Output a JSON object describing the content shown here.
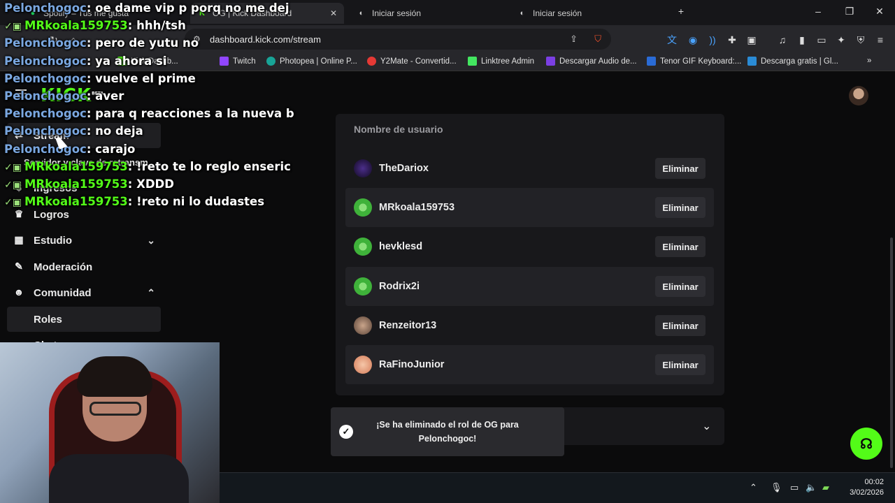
{
  "browser": {
    "tabs": [
      {
        "label": "Spotify – Tus me gusta"
      },
      {
        "label": "OG | Kick Dashboard"
      },
      {
        "label": "Iniciar sesión"
      },
      {
        "label": "Iniciar sesión"
      }
    ],
    "url": "dashboard.kick.com/stream",
    "bookmarks": [
      {
        "label": "Kick Dashb..."
      },
      {
        "label": "Twitch"
      },
      {
        "label": "Photopea | Online P..."
      },
      {
        "label": "Y2Mate - Convertid..."
      },
      {
        "label": "Linktree Admin"
      },
      {
        "label": "Descargar Audio de..."
      },
      {
        "label": "Tenor GIF Keyboard:..."
      },
      {
        "label": "Descarga gratis | Gl..."
      }
    ],
    "colors": {
      "chrome": "#27272b",
      "tabbar": "#161619"
    }
  },
  "app": {
    "logo": "KICK",
    "logo_tag": "BETA",
    "accent": "#53fc18",
    "sidebar": {
      "items": [
        {
          "label": "Stream",
          "icon": "stream-icon"
        },
        {
          "label": "Servidor y clave de retransm"
        },
        {
          "label": "Ingresos",
          "icon": "money-icon"
        },
        {
          "label": "Logros",
          "icon": "trophy-icon"
        },
        {
          "label": "Estudio",
          "icon": "studio-icon"
        },
        {
          "label": "Moderación",
          "icon": "wrench-icon"
        },
        {
          "label": "Comunidad",
          "icon": "people-icon"
        },
        {
          "label": "Roles"
        },
        {
          "label": "Chat"
        }
      ]
    },
    "table": {
      "column_header": "Nombre de usuario",
      "delete_label": "Eliminar",
      "rows": [
        {
          "username": "TheDariox",
          "avatar_color": "#2a1b4a"
        },
        {
          "username": "MRkoala159753",
          "avatar_color": "#3fb23a"
        },
        {
          "username": "hevklesd",
          "avatar_color": "#3fb23a"
        },
        {
          "username": "Rodrix2i",
          "avatar_color": "#3fb23a"
        },
        {
          "username": "Renzeitor13",
          "avatar_color": "#8a6b5b"
        },
        {
          "username": "RaFinoJunior",
          "avatar_color": "#e8a07a"
        }
      ]
    },
    "toast": {
      "message": "¡Se ha eliminado el rol de OG para Pelonchogoc!"
    }
  },
  "chat": {
    "messages": [
      {
        "user": "Pelonchogoc",
        "text": "oe dame vip p porq no me dej"
      },
      {
        "user": "MRkoala159753",
        "text": "hhh/tsh",
        "badge": true
      },
      {
        "user": "Pelonchogoc",
        "text": "pero de yutu no"
      },
      {
        "user": "Pelonchogoc",
        "text": "ya ahora si"
      },
      {
        "user": "Pelonchogoc",
        "text": "vuelve el prime"
      },
      {
        "user": "Pelonchogoc",
        "text": "aver"
      },
      {
        "user": "Pelonchogoc",
        "text": "para q reacciones a la nueva b"
      },
      {
        "user": "Pelonchogoc",
        "text": "no deja"
      },
      {
        "user": "Pelonchogoc",
        "text": "carajo"
      },
      {
        "user": "MRkoala159753",
        "text": "!reto te lo reglo enseric",
        "badge": true
      },
      {
        "user": "MRkoala159753",
        "text": "XDDD",
        "badge": true
      },
      {
        "user": "MRkoala159753",
        "text": "!reto ni lo dudastes",
        "badge": true
      }
    ]
  },
  "taskbar": {
    "time": "00:02",
    "date": "3/02/2026"
  }
}
